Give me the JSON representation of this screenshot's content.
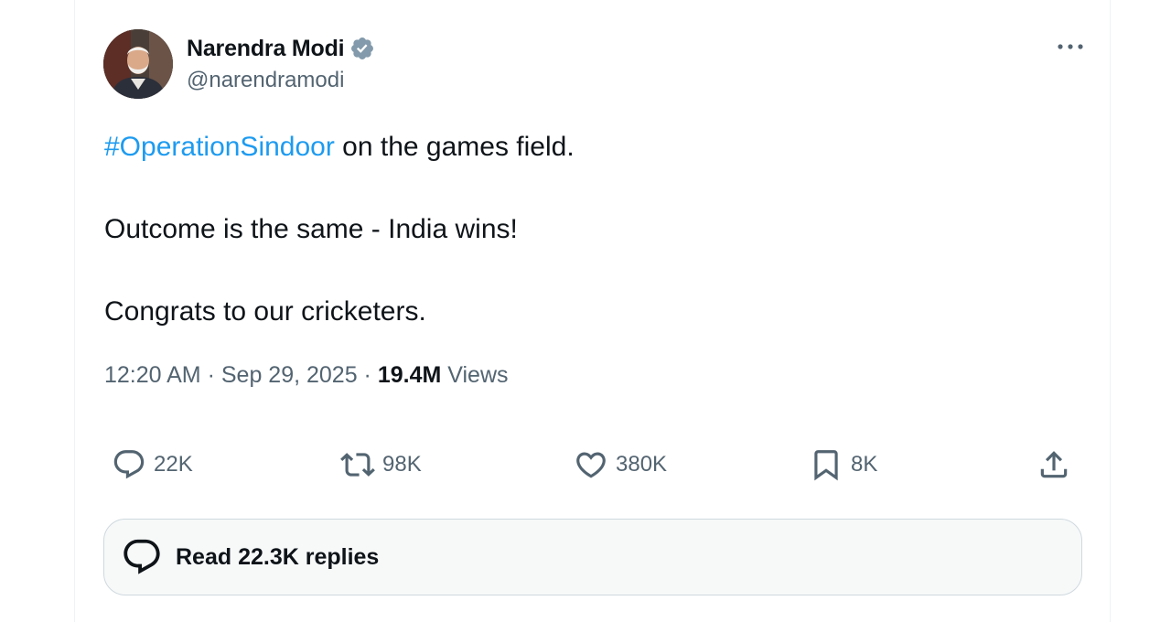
{
  "author": {
    "display_name": "Narendra Modi",
    "handle": "@narendramodi",
    "verified_icon": "verified-badge-icon",
    "verified_color": "#829aab"
  },
  "tweet": {
    "hashtag": "#OperationSindoor",
    "line1_rest": " on the games field.",
    "line2": "Outcome is the same - India wins!",
    "line3": "Congrats to our cricketers.",
    "time": "12:20 AM",
    "separator": " · ",
    "date": "Sep 29, 2025",
    "views_count": "19.4M",
    "views_label": " Views"
  },
  "actions": {
    "reply_count": "22K",
    "retweet_count": "98K",
    "like_count": "380K",
    "bookmark_count": "8K",
    "icons": [
      "reply-icon",
      "retweet-icon",
      "like-icon",
      "bookmark-icon",
      "share-icon"
    ]
  },
  "replies_button": {
    "label": "Read 22.3K replies"
  },
  "colors": {
    "accent": "#1d9bf0",
    "text_primary": "#0f1419",
    "text_secondary": "#536471"
  }
}
